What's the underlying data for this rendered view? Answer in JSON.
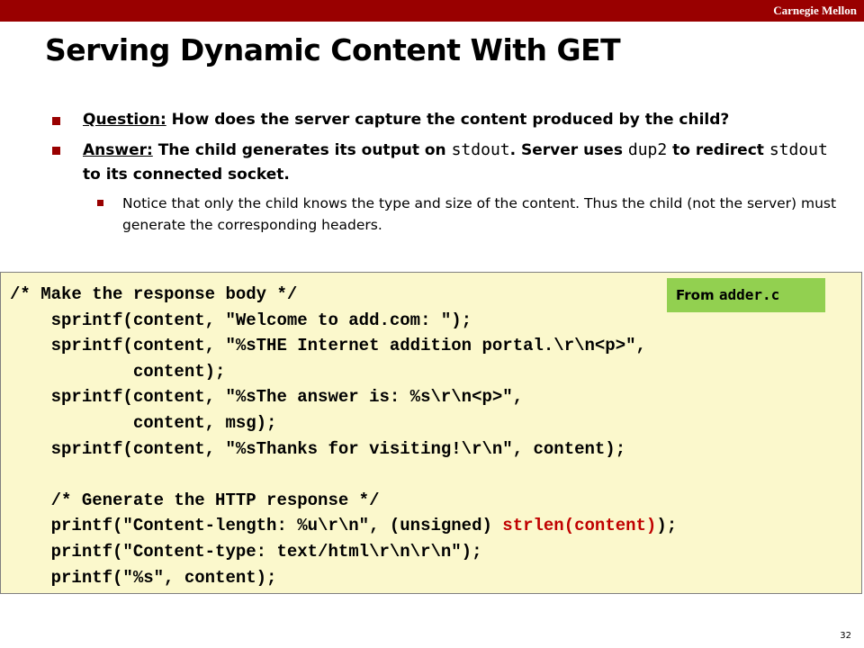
{
  "header": {
    "brand": "Carnegie Mellon"
  },
  "slide": {
    "title": "Serving Dynamic Content With GET",
    "bullets": {
      "q_label": "Question:",
      "q_text": " How does the server capture the content produced by the child?",
      "a_label": "Answer:",
      "a_text1": " The child generates its output on ",
      "a_code1": "stdout",
      "a_text2": ".  Server uses ",
      "a_code2": "dup2",
      "a_text3": "  to redirect ",
      "a_code3": "stdout",
      "a_text4": "  to its connected socket.",
      "sub": "Notice that only the child knows the type and size of the content. Thus the child (not the server) must generate the corresponding headers."
    },
    "code": {
      "l1": "/* Make the response body */",
      "l2": "    sprintf(content, \"Welcome to add.com: \");",
      "l3": "    sprintf(content, \"%sTHE Internet addition portal.\\r\\n<p>\", ",
      "l4": "            content);",
      "l5": "    sprintf(content, \"%sThe answer is: %s\\r\\n<p>\", ",
      "l6": "            content, msg);",
      "l7": "    sprintf(content, \"%sThanks for visiting!\\r\\n\", content);",
      "l8": "",
      "l9": "    /* Generate the HTTP response */",
      "l10a": "    printf(\"Content-length: %u\\r\\n\", (unsigned) ",
      "l10b": "strlen(content)",
      "l10c": ");",
      "l11": "    printf(\"Content-type: text/html\\r\\n\\r\\n\");",
      "l12": "    printf(\"%s\", content);"
    },
    "source_label": {
      "prefix": "From ",
      "file": "adder.c"
    },
    "page_number": "32"
  }
}
